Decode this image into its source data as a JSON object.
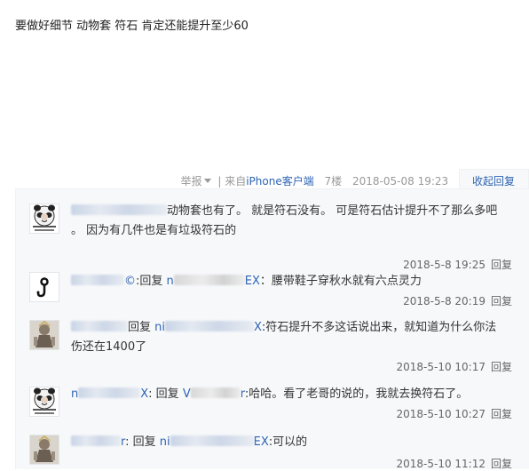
{
  "post": {
    "body": "要做好细节 动物套 符石 肯定还能提升至少60"
  },
  "tail": {
    "report": "举报",
    "sep": "|",
    "from_prefix": "来自",
    "from_link": "iPhone客户端",
    "floor": "7楼",
    "time": "2018-05-08 19:23",
    "fold_label": "收起回复"
  },
  "replies": [
    {
      "avatar": "panda-meme",
      "name_visible": "",
      "reply_prefix": "",
      "target_visible": "",
      "text_line1": "动物套也有了。 就是符石没有。 可是符石估计提升不了那么多吧",
      "text_line2": "。 因为有几件也是有垃圾符石的",
      "time": "2018-5-8 19:25",
      "reply_label": "回复"
    },
    {
      "avatar": "hook-symbol",
      "name_visible": "©",
      "reply_prefix": ":回复",
      "target_visible": "n",
      "target_suffix": "EX",
      "text_line1": "：腰带鞋子穿秋水就有六点灵力",
      "text_line2": "",
      "time": "2018-5-8 20:19",
      "reply_label": "回复"
    },
    {
      "avatar": "game-character",
      "name_visible": "",
      "reply_prefix": "回复",
      "target_visible": "ni",
      "target_suffix": "X",
      "text_line1": ":符石提升不多这话说出来，就知道为什么你法",
      "text_line2": "伤还在1400了",
      "time": "2018-5-10 10:17",
      "reply_label": "回复"
    },
    {
      "avatar": "panda-meme",
      "name_visible": "n",
      "name_suffix": "X",
      "reply_prefix": ": 回复",
      "target_visible": "V",
      "target_suffix": "r",
      "text_line1": ":哈哈。看了老哥的说的，我就去换符石了。",
      "text_line2": "",
      "time": "2018-5-10 10:27",
      "reply_label": "回复"
    },
    {
      "avatar": "game-character",
      "name_visible": "r",
      "reply_prefix": ": 回复",
      "target_visible": "ni",
      "target_suffix": "EX",
      "text_line1": ":可以的",
      "text_line2": "",
      "time": "2018-5-10 11:12",
      "reply_label": "回复"
    }
  ],
  "colors": {
    "link": "#2d64b3",
    "panel_bg": "#f7f8fa",
    "meta_text": "#666666"
  }
}
